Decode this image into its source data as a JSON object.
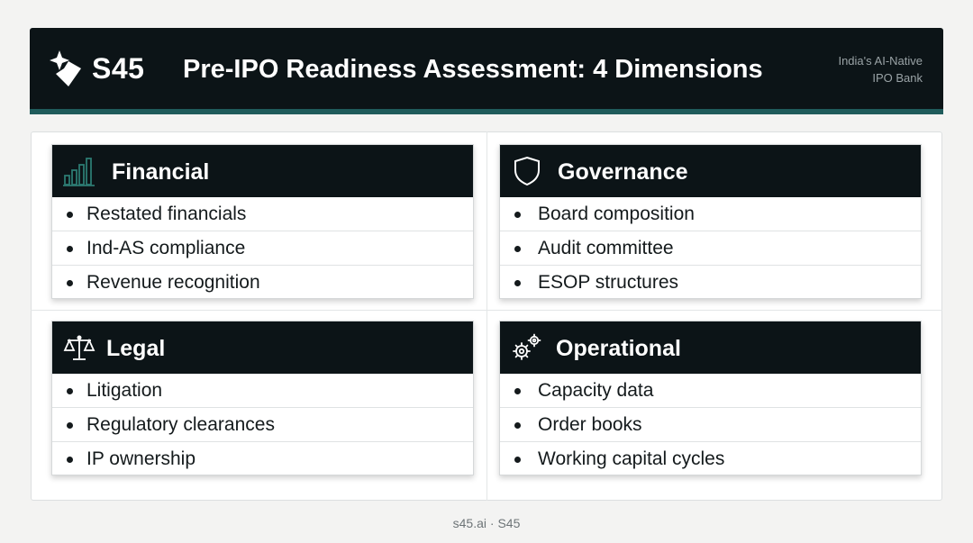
{
  "header": {
    "brand": "S45",
    "title": "Pre-IPO Readiness Assessment: 4 Dimensions",
    "tagline_line1": "India's AI-Native",
    "tagline_line2": "IPO Bank"
  },
  "dimensions": [
    {
      "title": "Financial",
      "icon": "bar-chart-icon",
      "items": [
        "Restated financials",
        "Ind-AS compliance",
        "Revenue recognition"
      ]
    },
    {
      "title": "Governance",
      "icon": "shield-icon",
      "items": [
        "Board composition",
        "Audit committee",
        "ESOP structures"
      ]
    },
    {
      "title": "Legal",
      "icon": "scales-icon",
      "items": [
        "Litigation",
        "Regulatory clearances",
        "IP ownership"
      ]
    },
    {
      "title": "Operational",
      "icon": "gears-icon",
      "items": [
        "Capacity data",
        "Order books",
        "Working capital cycles"
      ]
    }
  ],
  "footer": {
    "text": "s45.ai · S45"
  },
  "colors": {
    "header_bg": "#0c1417",
    "accent": "#1f5b5b",
    "icon_teal": "#2c7a72"
  }
}
